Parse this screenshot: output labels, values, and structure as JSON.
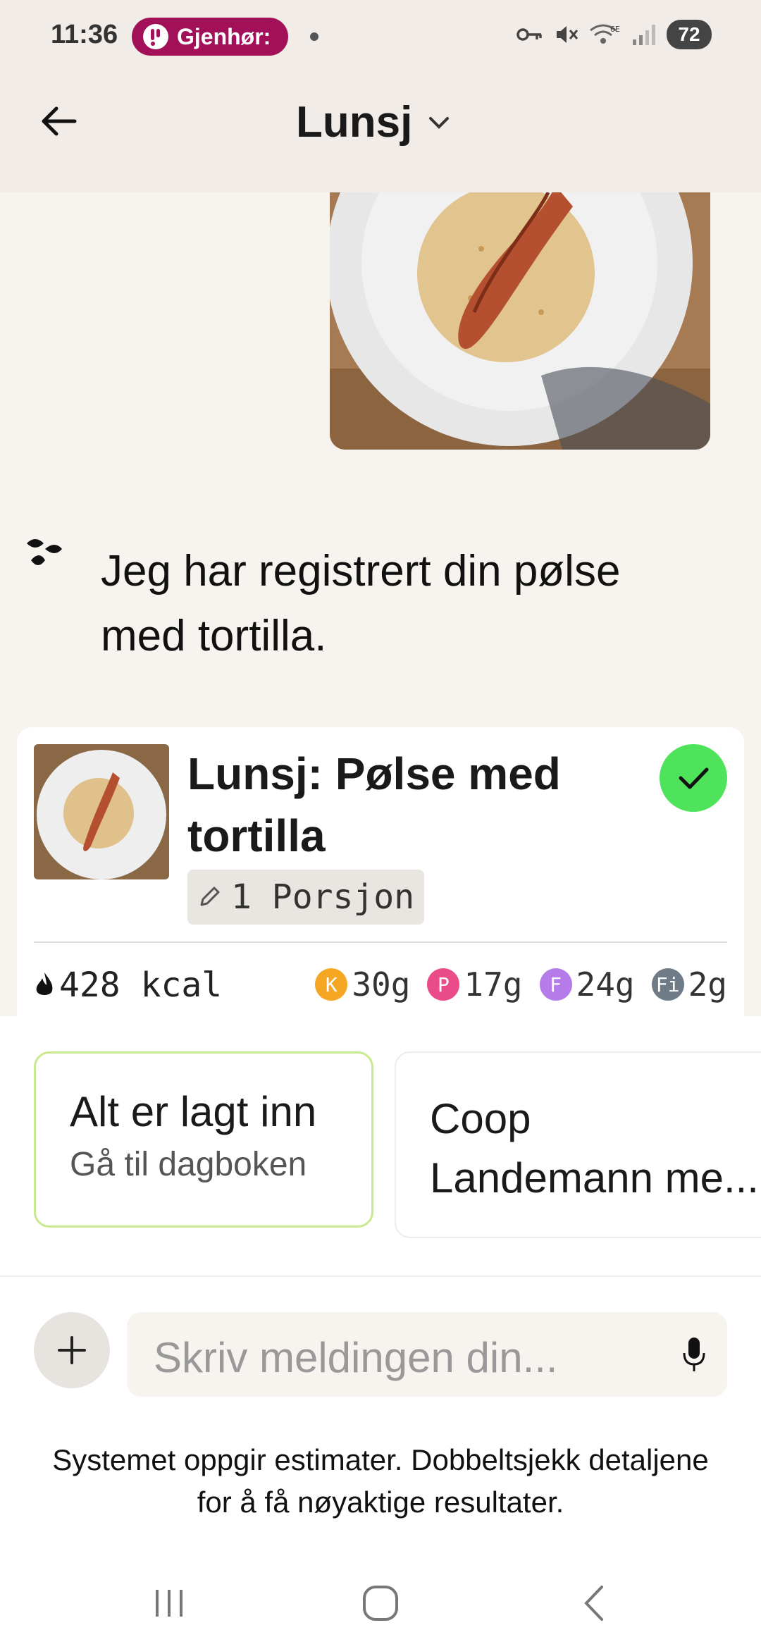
{
  "status_bar": {
    "time": "11:36",
    "app_pill": "Gjenhør:",
    "battery": "72",
    "icons": [
      "key-icon",
      "mute-icon",
      "wifi-6e-icon",
      "signal-icon",
      "battery-icon"
    ]
  },
  "header": {
    "title": "Lunsj",
    "icons": [
      "back-arrow-icon",
      "chevron-down-icon"
    ]
  },
  "chat": {
    "bot_message": "Jeg har registrert din pølse med tortilla."
  },
  "meal_card": {
    "title": "Lunsj: Pølse med tortilla",
    "portion": "1 Porsjon",
    "kcal": "428 kcal",
    "macros": [
      {
        "badge": "K",
        "value": "30g",
        "color": "#f5a623"
      },
      {
        "badge": "P",
        "value": "17g",
        "color": "#ea4c89"
      },
      {
        "badge": "F",
        "value": "24g",
        "color": "#b57be8"
      },
      {
        "badge": "Fi",
        "value": "2g",
        "color": "#6f7b86"
      }
    ]
  },
  "suggestions": [
    {
      "title": "Alt er lagt inn",
      "subtitle": "Gå til dagboken"
    },
    {
      "title": "Coop\nLandemann me..."
    }
  ],
  "composer": {
    "placeholder": "Skriv meldingen din..."
  },
  "disclaimer": "Systemet oppgir estimater. Dobbeltsjekk detaljene for å få nøyaktige resultater.",
  "colors": {
    "accent_pill": "#a3105a",
    "check_green": "#4ee35a",
    "background": "#f7f3ef"
  }
}
